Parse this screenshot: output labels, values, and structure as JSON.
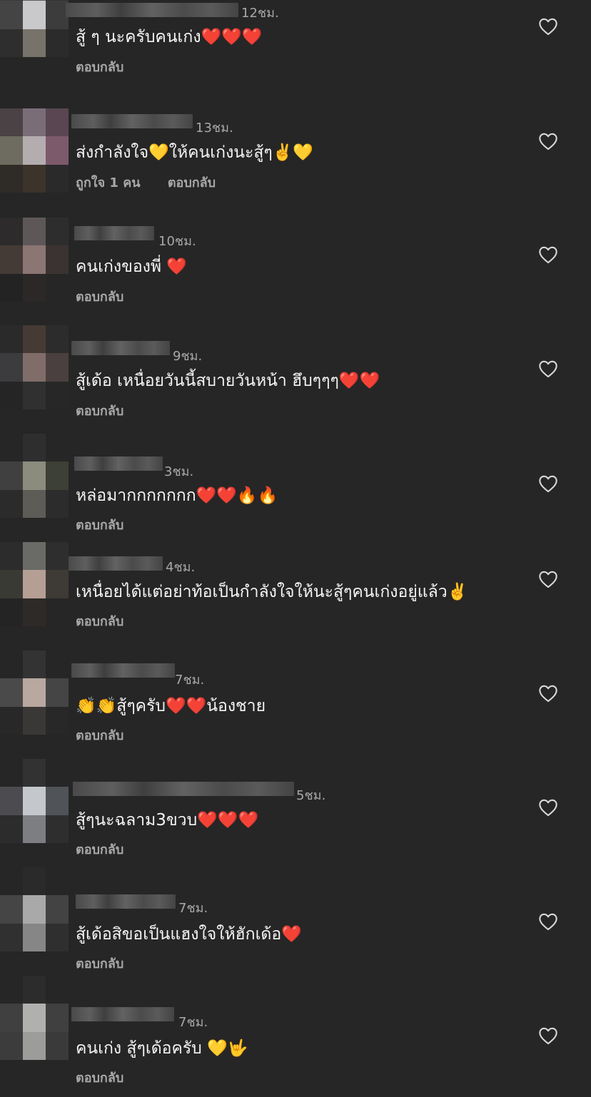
{
  "comments": [
    {
      "time": "12ชม.",
      "text": "สู้ ๆ นะครับคนเก่ง❤️❤️❤️",
      "likes": "",
      "reply": "ตอบกลับ"
    },
    {
      "time": "13ชม.",
      "text": "ส่งกำลังใจ💛ให้คนเก่งนะสู้ๆ✌️💛",
      "likes": "ถูกใจ 1 คน",
      "reply": "ตอบกลับ"
    },
    {
      "time": "10ชม.",
      "text": "คนเก่งของพี่ ❤️",
      "likes": "",
      "reply": "ตอบกลับ"
    },
    {
      "time": "9ชม.",
      "text": "สู้เด้อ เหนื่อยวันนี้สบายวันหน้า ฮึบๆๆๆ❤️❤️",
      "likes": "",
      "reply": "ตอบกลับ"
    },
    {
      "time": "3ชม.",
      "text": "หล่อมากกกกกกก❤️❤️🔥🔥",
      "likes": "",
      "reply": "ตอบกลับ"
    },
    {
      "time": "4ชม.",
      "text": "เหนื่อยได้แต่อย่าท้อเป็นกำลังใจให้นะสู้ๆคนเก่งอยู่แล้ว✌️",
      "likes": "",
      "reply": "ตอบกลับ"
    },
    {
      "time": "7ชม.",
      "text": "👏👏สู้ๆครับ❤️❤️น้องชาย",
      "likes": "",
      "reply": "ตอบกลับ"
    },
    {
      "time": "5ชม.",
      "text": "สู้ๆนะฉลาม3ขวบ❤️❤️❤️",
      "likes": "",
      "reply": "ตอบกลับ"
    },
    {
      "time": "7ชม.",
      "text": "สู้เด้อสิขอเป็นแฮงใจให้ฮักเด้อ❤️",
      "likes": "",
      "reply": "ตอบกลับ"
    },
    {
      "time": "7ชม.",
      "text": "คนเก่ง สู้ๆเด้อครับ 💛🤟",
      "likes": "",
      "reply": "ตอบกลับ"
    }
  ],
  "icons": {
    "like": "heart-outline-icon"
  },
  "colors": {
    "background": "#262626",
    "text": "#f5f5f5",
    "secondary": "#a8a8a8"
  }
}
